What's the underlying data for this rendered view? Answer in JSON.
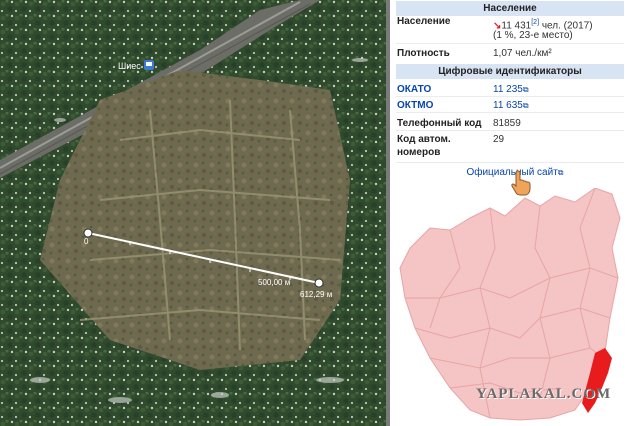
{
  "map": {
    "poi_label": "Шиес",
    "poi_icon": "train-station-icon",
    "ruler": {
      "start_label": "0",
      "mid_label": "500,00 м",
      "end_label": "612,29 м"
    }
  },
  "infobox": {
    "population_header": "Население",
    "population_label": "Население",
    "population_arrow": "↘",
    "population_value": "11 431",
    "population_ref": "[2]",
    "population_unit": "чел. (2017)",
    "population_rank": "(1 %, 23-е место)",
    "density_label": "Плотность",
    "density_value": "1,07 чел./км²",
    "identifiers_header": "Цифровые идентификаторы",
    "okato_label": "ОКАТО",
    "okato_value": "11 235",
    "oktmo_label": "ОКТМО",
    "oktmo_value": "11 635",
    "phone_label": "Телефонный код",
    "phone_value": "81859",
    "auto_code_label_1": "Код автом.",
    "auto_code_label_2": "номеров",
    "auto_code_value": "29",
    "official_site": "Официальный сайт"
  },
  "watermark": "YAPLAKAL.COM",
  "colors": {
    "map_region": "#f5c4c4",
    "highlight_region": "#e81c1c",
    "section_header": "#d8e3f4",
    "link": "#0645ad"
  }
}
